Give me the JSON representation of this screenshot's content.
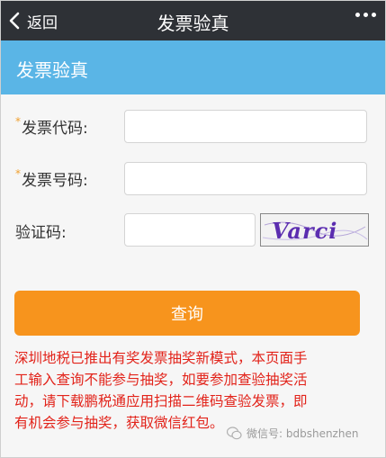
{
  "navbar": {
    "back_label": "返回",
    "title": "发票验真"
  },
  "hero": {
    "title": "发票验真"
  },
  "form": {
    "required_mark": "*",
    "invoice_code_label": "发票代码:",
    "invoice_number_label": "发票号码:",
    "captcha_label": "验证码:",
    "captcha_text": "Varci"
  },
  "query_button": "查询",
  "notice_lines": [
    "深圳地税已推出有奖发票抽奖新模式，本页面手",
    "工输入查询不能参与抽奖，如要参加查验抽奖活",
    "动，请下载鹏税通应用扫描二维码查验发票，即",
    "有机会参与抽奖，获取微信红包。"
  ],
  "watermark": "微信号: bdbshenzhen",
  "colors": {
    "navbar": "#2e3136",
    "hero": "#5ab5e6",
    "button": "#f7941d",
    "notice_text": "#e2231a",
    "required_mark": "#f0a030"
  }
}
